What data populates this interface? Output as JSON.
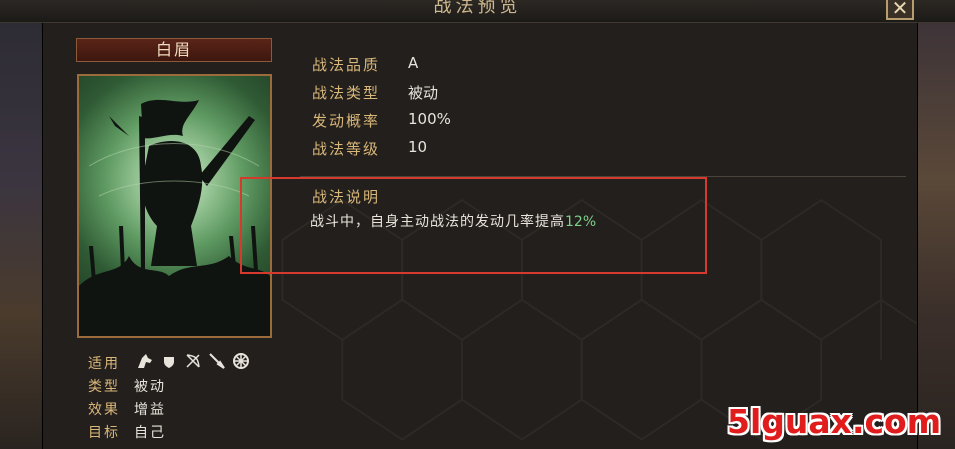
{
  "window": {
    "title": "战法预览",
    "close_icon": "close-icon"
  },
  "tactic": {
    "name": "白眉",
    "quality_label": "战法品质",
    "quality_value": "A",
    "type_label": "战法类型",
    "type_value": "被动",
    "rate_label": "发动概率",
    "rate_value": "100%",
    "level_label": "战法等级",
    "level_value": "10"
  },
  "description": {
    "title": "战法说明",
    "text": "战斗中，自身主动战法的发动几率提高",
    "highlight": "12%"
  },
  "meta": {
    "applicable_label": "适用",
    "applicable_icons": [
      "cavalry-icon",
      "shield-icon",
      "bow-icon",
      "spear-icon",
      "siege-icon"
    ],
    "kind_label": "类型",
    "kind_value": "被动",
    "effect_label": "效果",
    "effect_value": "增益",
    "target_label": "目标",
    "target_value": "自己"
  },
  "watermark": "5lguax.com",
  "colors": {
    "label": "#d9b77a",
    "value": "#e8e4dc",
    "highlight": "#7fd08a",
    "annotation_box": "#d63a2e"
  }
}
